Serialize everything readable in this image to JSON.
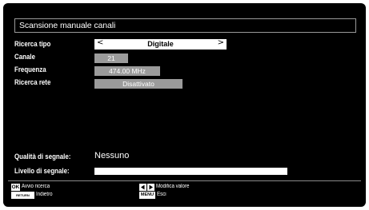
{
  "title": "Scansione manuale canali",
  "rows": {
    "ricerca_tipo": {
      "label": "Ricerca tipo",
      "value": "Digitale",
      "left_arrow": "<",
      "right_arrow": ">"
    },
    "canale": {
      "label": "Canale",
      "value": "21"
    },
    "frequenza": {
      "label": "Frequenza",
      "value": "474.00 MHz"
    },
    "ricerca_rete": {
      "label": "Ricerca rete",
      "value": "Disattivato"
    }
  },
  "signal": {
    "quality_label": "Qualità di segnale:",
    "quality_value": "Nessuno",
    "level_label": "Livello di segnale:",
    "level_fraction": 1.0
  },
  "footer": {
    "ok_key": "OK",
    "ok_hint": "Avvio ricerca",
    "return_key": "RETURN",
    "return_hint": "Indietro",
    "lr_hint": "Modifica valore",
    "menu_key": "MENU",
    "menu_hint": "Esci"
  },
  "colors": {
    "background": "#000000",
    "highlight": "#ffffff",
    "field": "#9b9b9b",
    "text": "#ffffff"
  },
  "icons": {
    "left_key": "left-triangle-icon",
    "right_key": "right-triangle-icon"
  }
}
